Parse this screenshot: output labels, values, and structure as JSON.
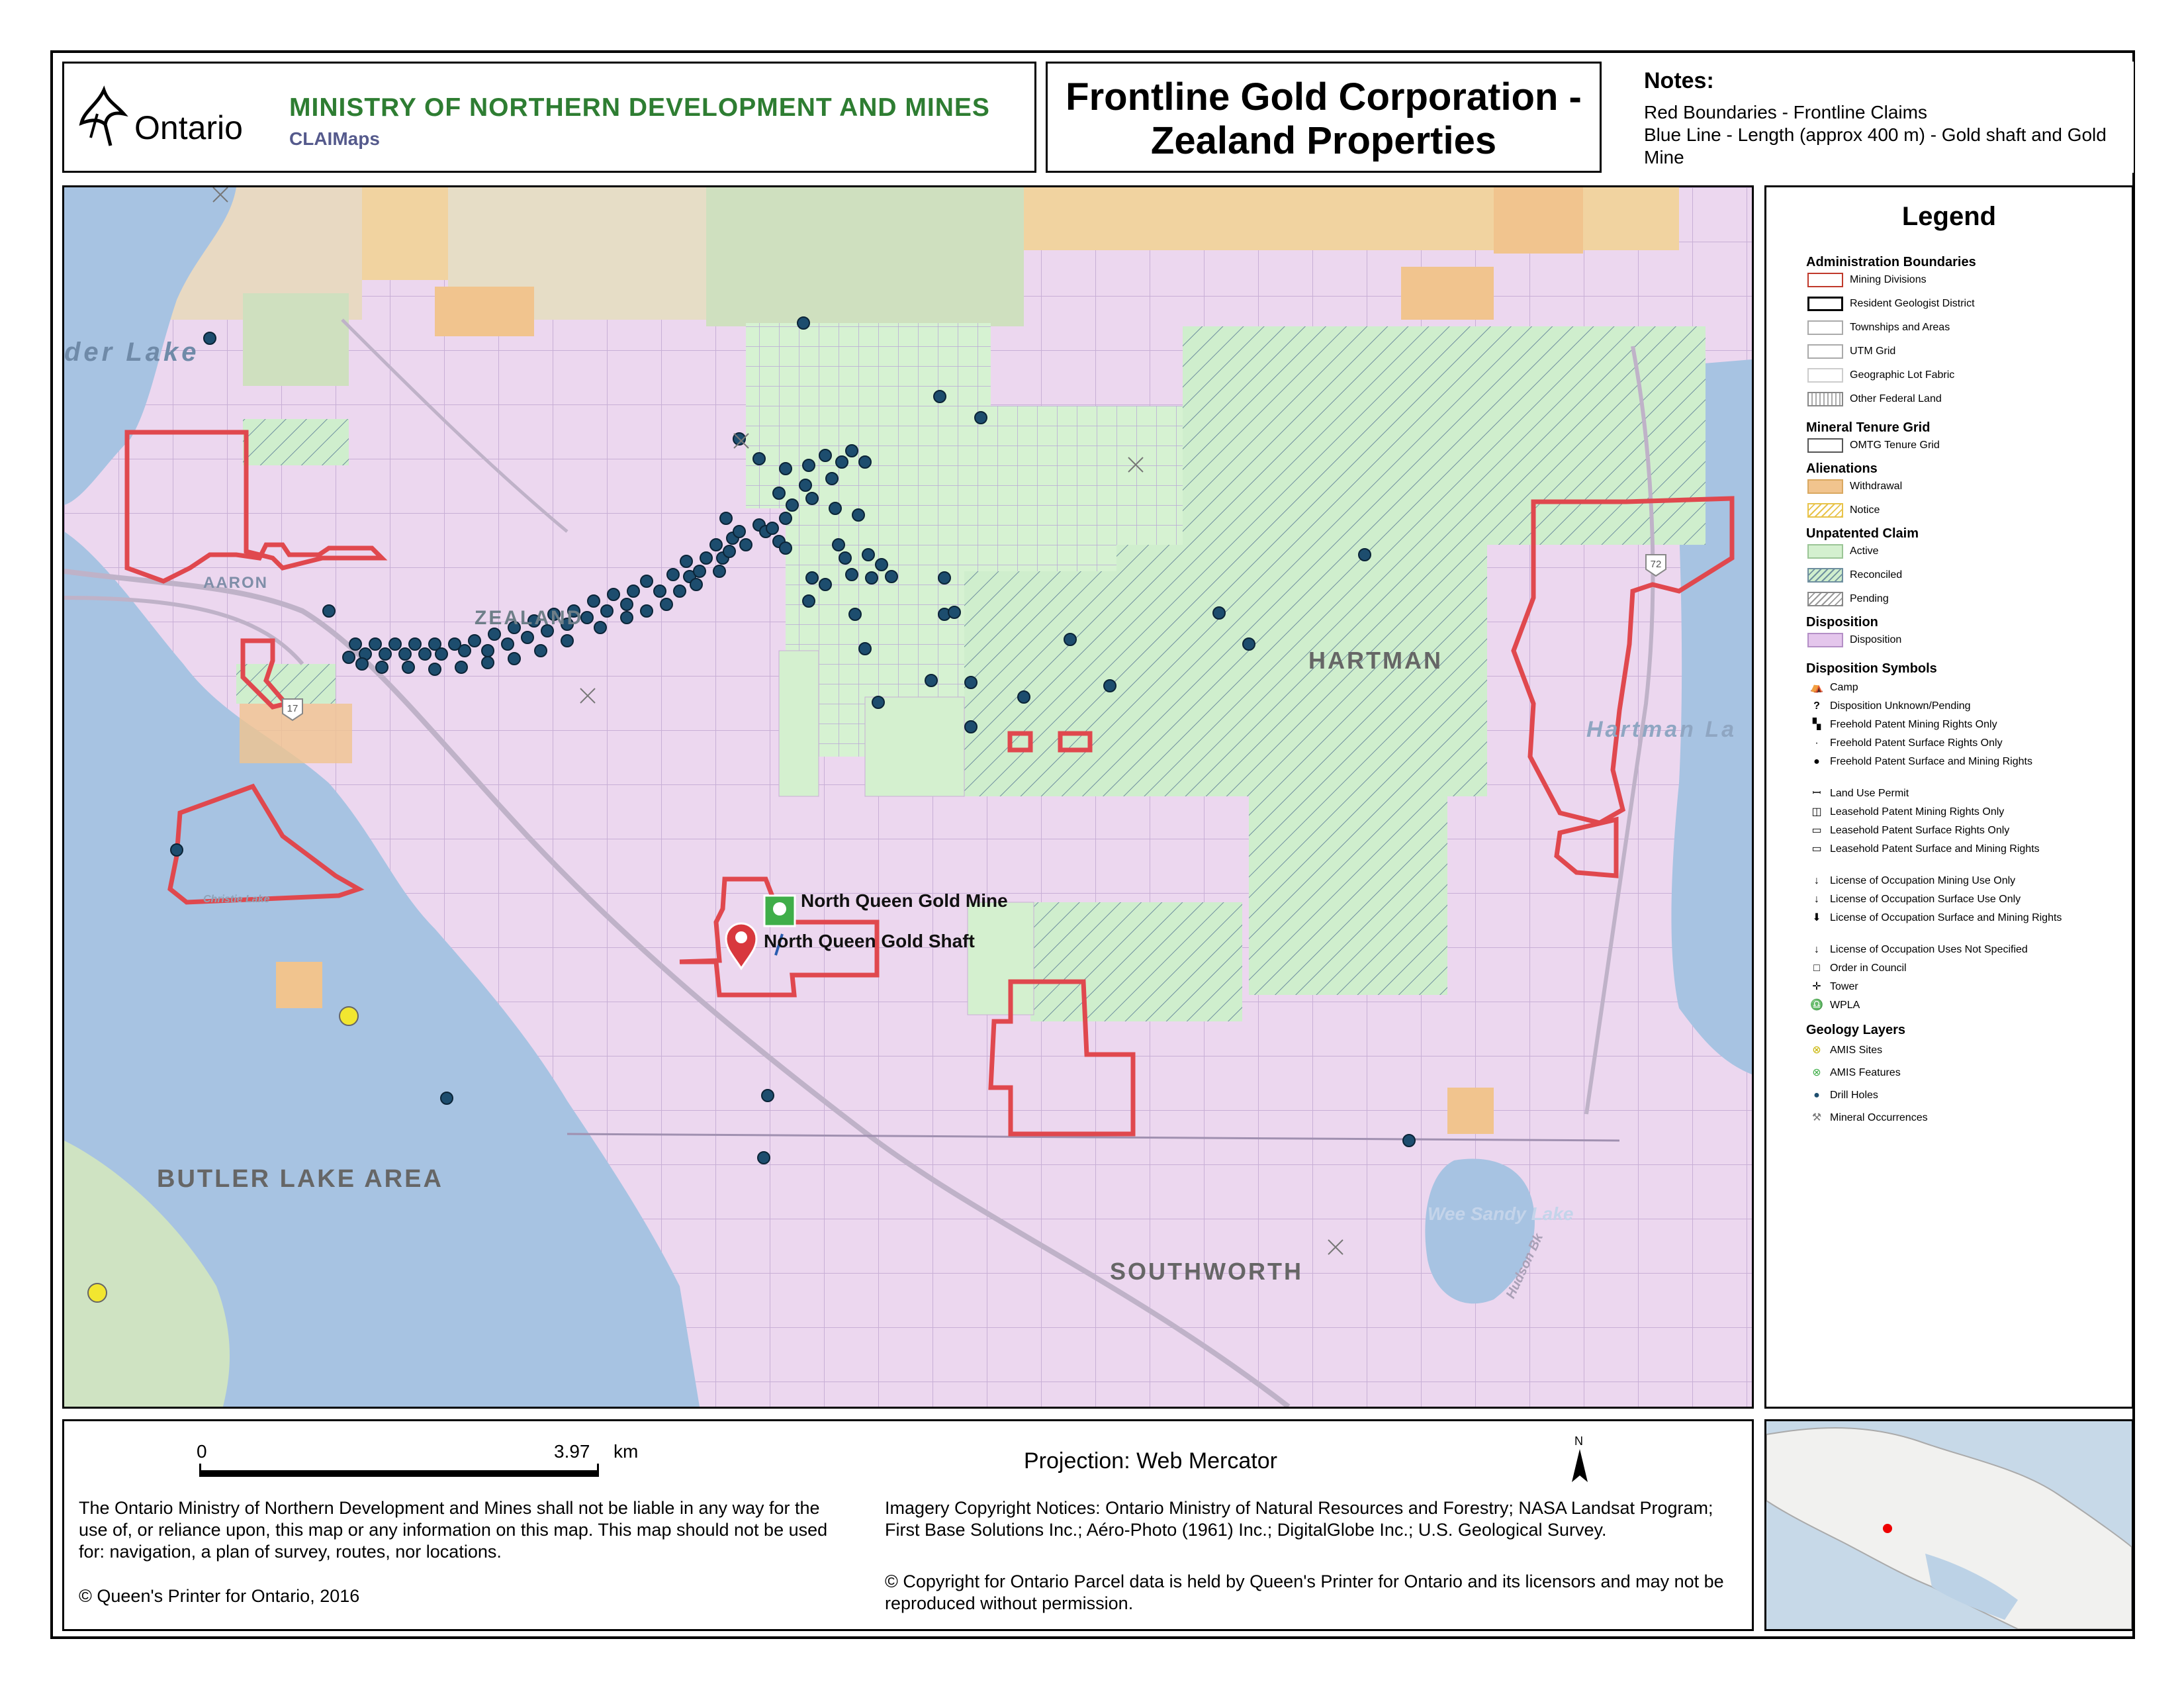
{
  "header": {
    "logo_text": "Ontario",
    "ministry": "MINISTRY OF NORTHERN DEVELOPMENT AND MINES",
    "app_name": "CLAIMaps",
    "title_line1": "Frontline Gold Corporation -",
    "title_line2": "Zealand Properties",
    "notes_heading": "Notes:",
    "notes_line1": "Red Boundaries - Frontline Claims",
    "notes_line2": "Blue Line - Length (approx 400 m) - Gold shaft and Gold Mine"
  },
  "map": {
    "labels": {
      "lake_top": "der Lake",
      "aaron": "AARON",
      "zealand": "ZEALAND",
      "hartman": "HARTMAN",
      "hartman_lake": "Hartman La",
      "butler": "BUTLER LAKE AREA",
      "southworth": "SOUTHWORTH",
      "wee_sandy": "Wee Sandy Lake",
      "christie": "Christie Lake",
      "hudson_bk": "Hudson Bk",
      "hwy": "17",
      "hwy2": "72"
    },
    "markers": {
      "mine": "North Queen Gold Mine",
      "shaft": "North Queen Gold Shaft"
    },
    "colors": {
      "disposition": "#ecd7ef",
      "active": "#d4f0cf",
      "withdrawal": "#f1c48e",
      "water": "#a7c3e2",
      "claims_boundary": "#e0484e",
      "drill_hole": "#1d4d6e"
    }
  },
  "legend": {
    "title": "Legend",
    "admin_heading": "Administration Boundaries",
    "admin_items": [
      "Mining Divisions",
      "Resident Geologist District",
      "Townships and Areas",
      "UTM Grid",
      "Geographic Lot Fabric",
      "Other Federal Land"
    ],
    "tenure_heading": "Mineral Tenure Grid",
    "tenure_items": [
      "OMTG Tenure Grid"
    ],
    "alien_heading": "Alienations",
    "alien_items": [
      "Withdrawal",
      "Notice"
    ],
    "unpat_heading": "Unpatented Claim",
    "unpat_items": [
      "Active",
      "Reconciled",
      "Pending"
    ],
    "disp_heading": "Disposition",
    "disp_items": [
      "Disposition"
    ],
    "symbols_heading": "Disposition Symbols",
    "symbols": [
      "Camp",
      "Disposition Unknown/Pending",
      "Freehold Patent Mining Rights Only",
      "Freehold Patent Surface Rights Only",
      "Freehold Patent Surface and Mining Rights",
      "Land Use Permit",
      "Leasehold Patent Mining Rights Only",
      "Leasehold Patent Surface Rights Only",
      "Leasehold Patent Surface and Mining Rights",
      "License of Occupation Mining Use Only",
      "License of Occupation Surface Use Only",
      "License of Occupation Surface and Mining Rights",
      "License of Occupation Uses Not Specified",
      "Order in Council",
      "Tower",
      "WPLA"
    ],
    "geo_heading": "Geology Layers",
    "geo_items": [
      "AMIS Sites",
      "AMIS Features",
      "Drill Holes",
      "Mineral Occurrences"
    ]
  },
  "footer": {
    "scale_zero": "0",
    "scale_value": "3.97",
    "scale_unit": "km",
    "projection": "Projection: Web Mercator",
    "north": "N",
    "disclaimer": "The Ontario Ministry of Northern Development and Mines shall not be liable in any way for the use of, or reliance upon, this map or any information on this map.  This map should not be used for: navigation, a plan of survey, routes, nor locations.",
    "copyright_qp": "© Queen's Printer for Ontario, 2016",
    "imagery": "Imagery Copyright Notices: Ontario Ministry of Natural Resources and Forestry; NASA Landsat Program; First Base Solutions Inc.; Aéro-Photo (1961) Inc.; DigitalGlobe Inc.; U.S. Geological Survey.",
    "parcel": "© Copyright for Ontario Parcel data is held by Queen's Printer for Ontario and its licensors and may not be reproduced without permission."
  }
}
